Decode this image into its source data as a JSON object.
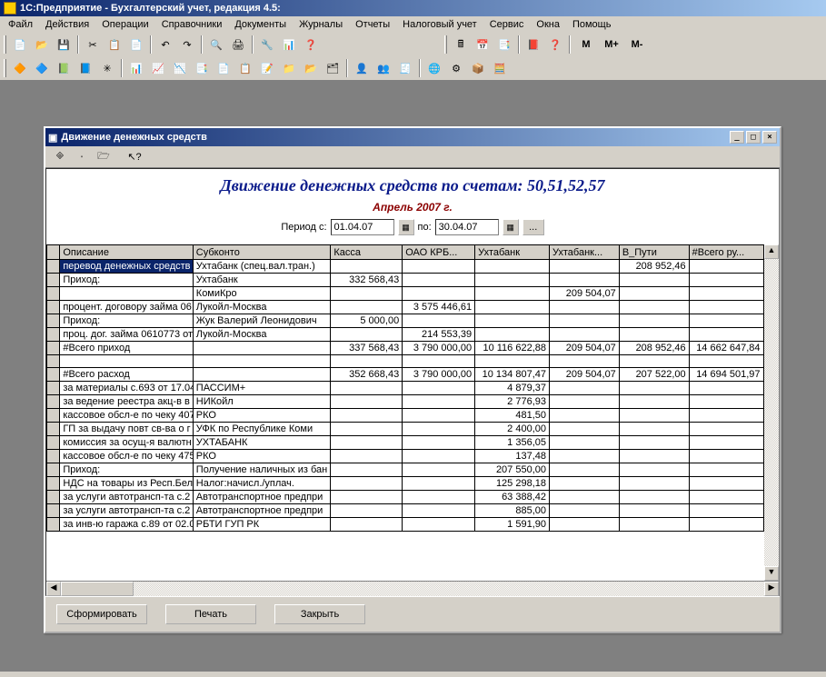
{
  "app": {
    "title": "1С:Предприятие - Бухгалтерский учет, редакция 4.5:"
  },
  "menu": [
    "Файл",
    "Действия",
    "Операции",
    "Справочники",
    "Документы",
    "Журналы",
    "Отчеты",
    "Налоговый учет",
    "Сервис",
    "Окна",
    "Помощь"
  ],
  "tb_btns": {
    "m": "M",
    "mp": "M+",
    "mm": "M-"
  },
  "childwin": {
    "title": "Движение денежных средств",
    "minimize": "_",
    "maximize": "□",
    "close": "×"
  },
  "report": {
    "title": "Движение денежных средств по счетам: 50,51,52,57",
    "period_label": "Апрель 2007 г.",
    "from_label": "Период с:",
    "from_value": "01.04.07",
    "to_label": "по:",
    "to_value": "30.04.07",
    "dots": "..."
  },
  "columns": [
    "Описание",
    "Субконто",
    "Касса",
    "ОАО КРБ...",
    "Ухтабанк",
    "Ухтабанк...",
    "В_Пути",
    "#Всего ру..."
  ],
  "rows": [
    {
      "sel": true,
      "d": "перевод денежных средств",
      "s": "Ухтабанк (спец.вал.тран.)",
      "k": "",
      "o": "",
      "u": "",
      "u2": "",
      "v": "208 952,46",
      "t": ""
    },
    {
      "d": "Приход:",
      "s": "Ухтабанк",
      "k": "332 568,43",
      "o": "",
      "u": "",
      "u2": "",
      "v": "",
      "t": ""
    },
    {
      "d": "",
      "s": "КомиКро",
      "k": "",
      "o": "",
      "u": "",
      "u2": "209 504,07",
      "v": "",
      "t": ""
    },
    {
      "d": "процент. договору займа 06",
      "s": "Лукойл-Москва",
      "k": "",
      "o": "3 575 446,61",
      "u": "",
      "u2": "",
      "v": "",
      "t": ""
    },
    {
      "d": "Приход:",
      "s": "Жук Валерий Леонидович",
      "k": "5 000,00",
      "o": "",
      "u": "",
      "u2": "",
      "v": "",
      "t": ""
    },
    {
      "d": "проц. дог. займа 0610773 от",
      "s": "Лукойл-Москва",
      "k": "",
      "o": "214 553,39",
      "u": "",
      "u2": "",
      "v": "",
      "t": ""
    },
    {
      "d": "#Всего приход",
      "s": "",
      "k": "337 568,43",
      "o": "3 790 000,00",
      "u": "10 116 622,88",
      "u2": "209 504,07",
      "v": "208 952,46",
      "t": "14 662 647,84"
    },
    {
      "blank": true
    },
    {
      "d": "#Всего расход",
      "s": "",
      "k": "352 668,43",
      "o": "3 790 000,00",
      "u": "10 134 807,47",
      "u2": "209 504,07",
      "v": "207 522,00",
      "t": "14 694 501,97"
    },
    {
      "d": "за материалы с.693 от 17.04",
      "s": "ПАССИМ+",
      "k": "",
      "o": "",
      "u": "4 879,37",
      "u2": "",
      "v": "",
      "t": ""
    },
    {
      "d": "за ведение реестра акц-в в",
      "s": "НИКойл",
      "k": "",
      "o": "",
      "u": "2 776,93",
      "u2": "",
      "v": "",
      "t": ""
    },
    {
      "d": "кассовое обсл-е по чеку 407",
      "s": "РКО",
      "k": "",
      "o": "",
      "u": "481,50",
      "u2": "",
      "v": "",
      "t": ""
    },
    {
      "d": "ГП за выдачу повт св-ва о г",
      "s": "УФК по Республике Коми",
      "k": "",
      "o": "",
      "u": "2 400,00",
      "u2": "",
      "v": "",
      "t": ""
    },
    {
      "d": "комиссия за осущ-я валютн",
      "s": "УХТАБАНК",
      "k": "",
      "o": "",
      "u": "1 356,05",
      "u2": "",
      "v": "",
      "t": ""
    },
    {
      "d": "кассовое обсл-е по чеку 475",
      "s": "РКО",
      "k": "",
      "o": "",
      "u": "137,48",
      "u2": "",
      "v": "",
      "t": ""
    },
    {
      "d": "Приход:",
      "s": "Получение наличных из бан",
      "k": "",
      "o": "",
      "u": "207 550,00",
      "u2": "",
      "v": "",
      "t": ""
    },
    {
      "d": "НДС на товары из Респ.Бел",
      "s": "Налог:начисл./уплач.",
      "k": "",
      "o": "",
      "u": "125 298,18",
      "u2": "",
      "v": "",
      "t": ""
    },
    {
      "d": "за услуги автотрансп-та с.2",
      "s": "Автотранспортное предпри",
      "k": "",
      "o": "",
      "u": "63 388,42",
      "u2": "",
      "v": "",
      "t": ""
    },
    {
      "d": "за услуги автотрансп-та с.2",
      "s": "Автотранспортное предпри",
      "k": "",
      "o": "",
      "u": "885,00",
      "u2": "",
      "v": "",
      "t": ""
    },
    {
      "d": "за инв-ю гаража с.89 от 02.0",
      "s": "РБТИ ГУП РК",
      "k": "",
      "o": "",
      "u": "1 591,90",
      "u2": "",
      "v": "",
      "t": ""
    }
  ],
  "buttons": {
    "generate": "Сформировать",
    "print": "Печать",
    "close": "Закрыть"
  }
}
